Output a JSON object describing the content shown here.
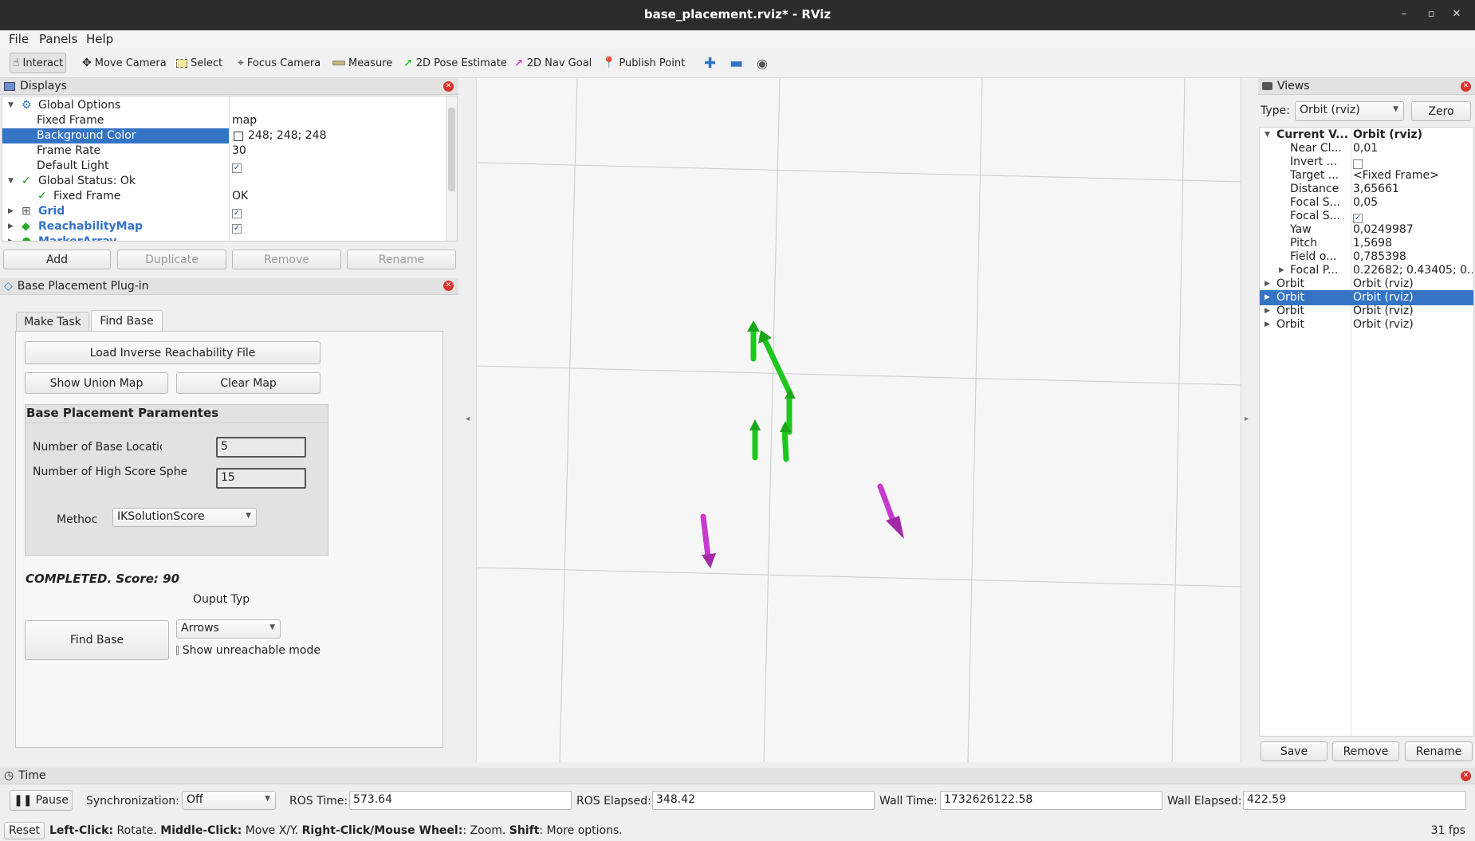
{
  "window": {
    "title": "base_placement.rviz* - RViz",
    "minimize": "–",
    "maximize": "▫",
    "close": "✕"
  },
  "menu": {
    "file": "File",
    "panels": "Panels",
    "help": "Help"
  },
  "toolbar": {
    "interact": "Interact",
    "move_camera": "Move Camera",
    "select": "Select",
    "focus_camera": "Focus Camera",
    "measure": "Measure",
    "pose_estimate": "2D Pose Estimate",
    "nav_goal": "2D Nav Goal",
    "publish_point": "Publish Point"
  },
  "displays": {
    "title": "Displays",
    "global_options": "Global Options",
    "fixed_frame": {
      "label": "Fixed Frame",
      "value": "map"
    },
    "background_color": {
      "label": "Background Color",
      "value": "248; 248; 248"
    },
    "frame_rate": {
      "label": "Frame Rate",
      "value": "30"
    },
    "default_light": {
      "label": "Default Light"
    },
    "global_status": "Global Status: Ok",
    "status_fixed_frame": {
      "label": "Fixed Frame",
      "value": "OK"
    },
    "grid": "Grid",
    "reachability": "ReachabilityMap",
    "marker": "MarkerArray",
    "buttons": {
      "add": "Add",
      "duplicate": "Duplicate",
      "remove": "Remove",
      "rename": "Rename"
    }
  },
  "plugin": {
    "title": "Base Placement Plug-in",
    "tabs": {
      "make_task": "Make Task",
      "find_base": "Find Base"
    },
    "load_file": "Load Inverse Reachability File",
    "show_union": "Show Union Map",
    "clear_map": "Clear Map",
    "params_title": "Base Placement Paramentes",
    "num_base_label": "Number of Base Locatio",
    "num_base_value": "5",
    "num_high_label": "Number of High Score Spher",
    "num_high_value": "15",
    "method_label": "Methoc",
    "method_value": "IKSolutionScore",
    "status": "COMPLETED. Score: 90",
    "output_label": "Ouput Typ",
    "output_value": "Arrows",
    "find_base": "Find Base",
    "show_unreachable": "Show unreachable mode"
  },
  "views": {
    "title": "Views",
    "type_label": "Type:",
    "type_value": "Orbit (rviz)",
    "zero": "Zero",
    "rows": [
      {
        "key": "Current V...",
        "value": "Orbit (rviz)"
      },
      {
        "key": "Near Cl...",
        "value": "0,01"
      },
      {
        "key": "Invert ...",
        "value": ""
      },
      {
        "key": "Target ...",
        "value": "<Fixed Frame>"
      },
      {
        "key": "Distance",
        "value": "3,65661"
      },
      {
        "key": "Focal S...",
        "value": "0,05"
      },
      {
        "key": "Focal S...",
        "value": ""
      },
      {
        "key": "Yaw",
        "value": "0,0249987"
      },
      {
        "key": "Pitch",
        "value": "1,5698"
      },
      {
        "key": "Field o...",
        "value": "0,785398"
      },
      {
        "key": "Focal P...",
        "value": "0.22682; 0.43405; 0...."
      },
      {
        "key": "Orbit",
        "value": "Orbit (rviz)"
      },
      {
        "key": "Orbit",
        "value": "Orbit (rviz)"
      },
      {
        "key": "Orbit",
        "value": "Orbit (rviz)"
      },
      {
        "key": "Orbit",
        "value": "Orbit (rviz)"
      }
    ],
    "save": "Save",
    "remove": "Remove",
    "rename": "Rename"
  },
  "time": {
    "title": "Time",
    "pause": "Pause",
    "sync_label": "Synchronization:",
    "sync_value": "Off",
    "ros_time_label": "ROS Time:",
    "ros_time": "573.64",
    "ros_elapsed_label": "ROS Elapsed:",
    "ros_elapsed": "348.42",
    "wall_time_label": "Wall Time:",
    "wall_time": "1732626122.58",
    "wall_elapsed_label": "Wall Elapsed:",
    "wall_elapsed": "422.59"
  },
  "status": {
    "reset": "Reset",
    "left": "Left-Click:",
    "left_desc": " Rotate. ",
    "middle": "Middle-Click:",
    "middle_desc": " Move X/Y. ",
    "right": "Right-Click/Mouse Wheel:",
    "right_desc": ": Zoom. ",
    "shift": "Shift",
    "shift_desc": ": More options.",
    "fps": "31 fps"
  },
  "colors": {
    "selection": "#3574c4",
    "green_arrow": "#1ec61e",
    "magenta_arrow": "#c53ccd",
    "close": "#d9342b"
  }
}
